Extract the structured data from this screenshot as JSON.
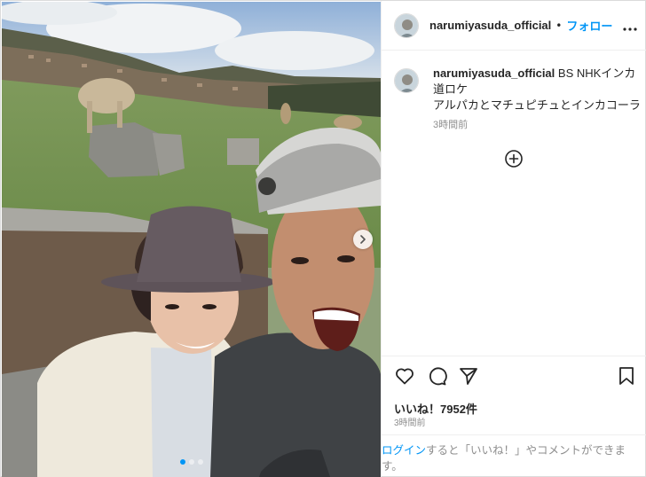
{
  "post": {
    "username": "narumiyasuda_official",
    "separator": "•",
    "follow_label": "フォロー",
    "more_icon": "more-horizontal-icon"
  },
  "caption": {
    "username": "narumiyasuda_official",
    "text_line1": " BS NHKインカ道ロケ",
    "text_line2": "アルパカとマチュピチュとインカコーラ",
    "time": "3時間前"
  },
  "photo": {
    "carousel_total": 3,
    "carousel_index": 1,
    "next_icon": "chevron-right-icon"
  },
  "actions": {
    "like_icon": "heart-icon",
    "comment_icon": "comment-icon",
    "share_icon": "send-icon",
    "save_icon": "bookmark-icon"
  },
  "likes": {
    "text": "いいね！7952件"
  },
  "post_time": "3時間前",
  "login_prompt": {
    "link": "ログイン",
    "rest": "すると「いいね！」やコメントができます。"
  },
  "colors": {
    "link_blue": "#0095f6",
    "text": "#262626",
    "muted": "#8e8e8e",
    "border": "#efefef"
  }
}
